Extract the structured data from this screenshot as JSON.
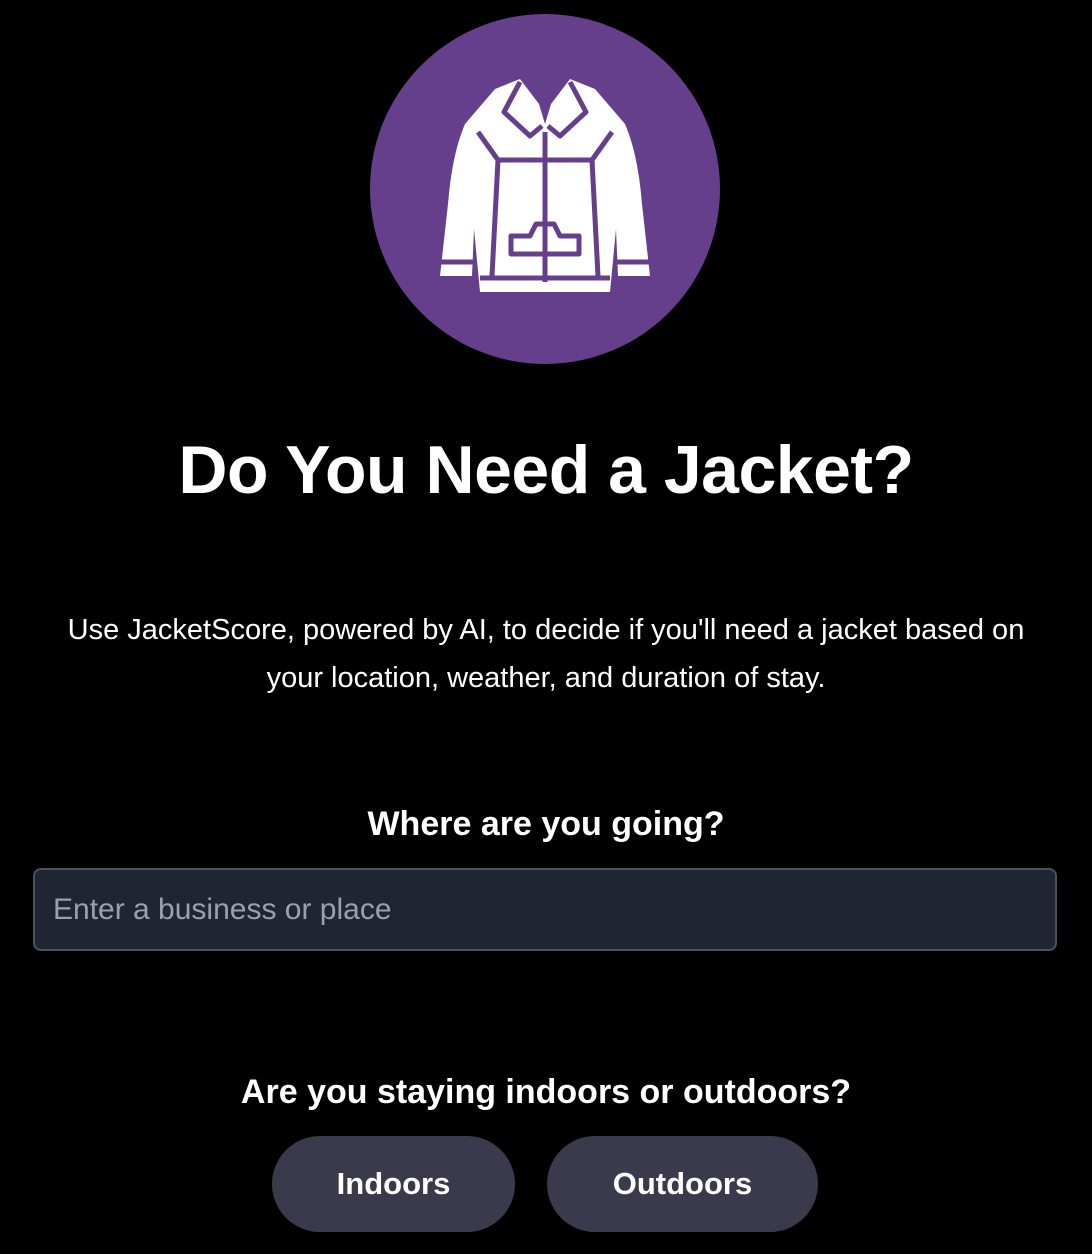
{
  "logo": {
    "icon": "jacket-icon",
    "background_color": "#653f8c"
  },
  "hero": {
    "title": "Do You Need a Jacket?",
    "description": "Use JacketScore, powered by AI, to decide if you'll need a jacket based on your location, weather, and duration of stay."
  },
  "location": {
    "question": "Where are you going?",
    "placeholder": "Enter a business or place",
    "value": ""
  },
  "setting": {
    "question": "Are you staying indoors or outdoors?",
    "options": [
      "Indoors",
      "Outdoors"
    ]
  }
}
